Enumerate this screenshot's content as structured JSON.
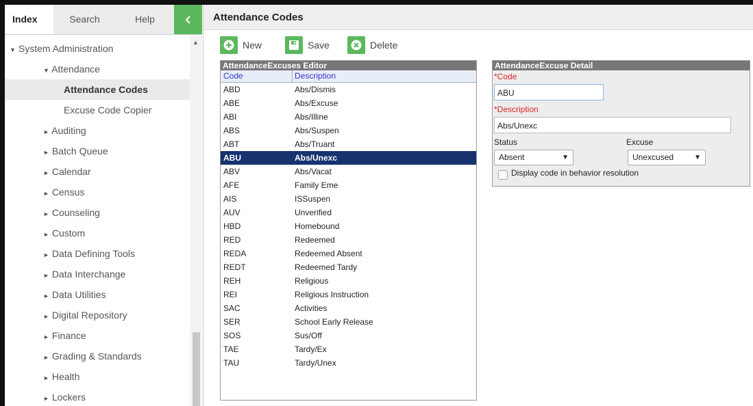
{
  "nav": {
    "tabs": [
      "Index",
      "Search",
      "Help"
    ],
    "collapse_icon": "chevron-left-icon",
    "tree": [
      {
        "label": "System Administration",
        "indent": 0,
        "arrow": "▼"
      },
      {
        "label": "Attendance",
        "indent": 1,
        "arrow": "▼"
      },
      {
        "label": "Attendance Codes",
        "indent": 2,
        "arrow": "",
        "selected": true
      },
      {
        "label": "Excuse Code Copier",
        "indent": 2,
        "arrow": ""
      },
      {
        "label": "Auditing",
        "indent": 1,
        "arrow": "►"
      },
      {
        "label": "Batch Queue",
        "indent": 1,
        "arrow": "►"
      },
      {
        "label": "Calendar",
        "indent": 1,
        "arrow": "►"
      },
      {
        "label": "Census",
        "indent": 1,
        "arrow": "►"
      },
      {
        "label": "Counseling",
        "indent": 1,
        "arrow": "►"
      },
      {
        "label": "Custom",
        "indent": 1,
        "arrow": "►"
      },
      {
        "label": "Data Defining Tools",
        "indent": 1,
        "arrow": "►"
      },
      {
        "label": "Data Interchange",
        "indent": 1,
        "arrow": "►"
      },
      {
        "label": "Data Utilities",
        "indent": 1,
        "arrow": "►"
      },
      {
        "label": "Digital Repository",
        "indent": 1,
        "arrow": "►"
      },
      {
        "label": "Finance",
        "indent": 1,
        "arrow": "►"
      },
      {
        "label": "Grading & Standards",
        "indent": 1,
        "arrow": "►"
      },
      {
        "label": "Health",
        "indent": 1,
        "arrow": "►"
      },
      {
        "label": "Lockers",
        "indent": 1,
        "arrow": "►"
      }
    ]
  },
  "page": {
    "title": "Attendance Codes"
  },
  "toolbar": {
    "new_label": "New",
    "save_label": "Save",
    "delete_label": "Delete",
    "accent": "#5cb85c"
  },
  "editor": {
    "title": "AttendanceExcuses Editor",
    "columns": [
      "Code",
      "Description"
    ],
    "rows": [
      {
        "code": "ABD",
        "description": "Abs/Dismis"
      },
      {
        "code": "ABE",
        "description": "Abs/Excuse"
      },
      {
        "code": "ABI",
        "description": "Abs/Illine"
      },
      {
        "code": "ABS",
        "description": "Abs/Suspen"
      },
      {
        "code": "ABT",
        "description": "Abs/Truant"
      },
      {
        "code": "ABU",
        "description": "Abs/Unexc",
        "selected": true
      },
      {
        "code": "ABV",
        "description": "Abs/Vacat"
      },
      {
        "code": "AFE",
        "description": "Family Eme"
      },
      {
        "code": "AIS",
        "description": "ISSuspen"
      },
      {
        "code": "AUV",
        "description": "Unverified"
      },
      {
        "code": "HBD",
        "description": "Homebound"
      },
      {
        "code": "RED",
        "description": "Redeemed"
      },
      {
        "code": "REDA",
        "description": "Redeemed Absent"
      },
      {
        "code": "REDT",
        "description": "Redeemed Tardy"
      },
      {
        "code": "REH",
        "description": "Religious"
      },
      {
        "code": "REI",
        "description": "Religious Instruction"
      },
      {
        "code": "SAC",
        "description": "Activities"
      },
      {
        "code": "SER",
        "description": "School Early Release"
      },
      {
        "code": "SOS",
        "description": "Sus/Off"
      },
      {
        "code": "TAE",
        "description": "Tardy/Ex"
      },
      {
        "code": "TAU",
        "description": "Tardy/Unex"
      }
    ]
  },
  "detail": {
    "title": "AttendanceExcuse Detail",
    "code_label": "*Code",
    "code_value": "ABU",
    "description_label": "*Description",
    "description_value": "Abs/Unexc",
    "status_label": "Status",
    "status_value": "Absent",
    "excuse_label": "Excuse",
    "excuse_value": "Unexcused",
    "behavior_checkbox_label": "Display code in behavior resolution",
    "behavior_checked": false
  }
}
